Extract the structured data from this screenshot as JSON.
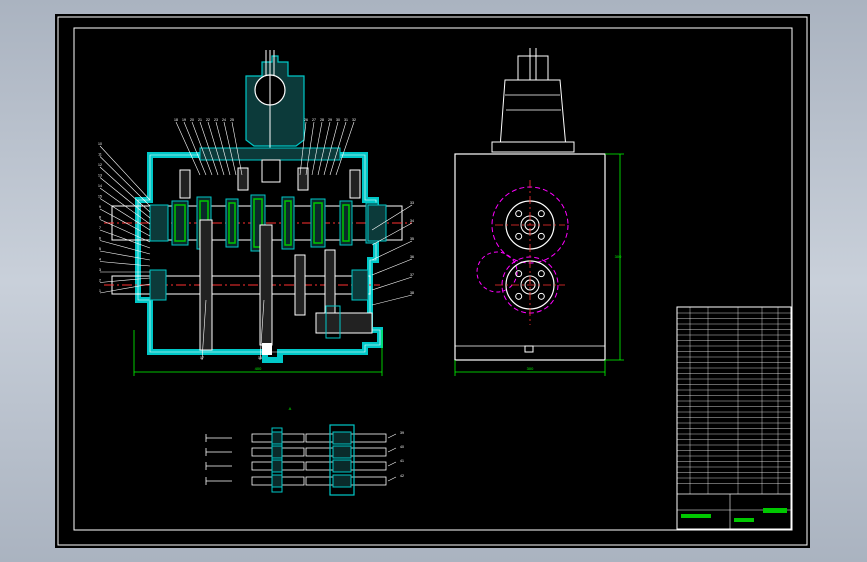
{
  "drawing": {
    "title_block_label": "",
    "section_label": "A",
    "dimensions": {
      "width_left": "400",
      "width_right": "300",
      "height_right": "300"
    },
    "balloons_top_left": [
      "18",
      "19",
      "20",
      "21",
      "22",
      "23",
      "24",
      "25"
    ],
    "balloons_top_right": [
      "26",
      "27",
      "28",
      "29",
      "30",
      "31",
      "32"
    ],
    "balloons_left": [
      "10",
      "11",
      "12",
      "13",
      "14",
      "15",
      "9",
      "8",
      "7",
      "6",
      "5",
      "4",
      "3",
      "2",
      "1"
    ],
    "balloons_right": [
      "33",
      "34",
      "35",
      "36",
      "37",
      "38"
    ],
    "balloons_bottom": [
      "17",
      "16"
    ],
    "rod_labels": [
      "39",
      "40",
      "41",
      "42"
    ],
    "colors": {
      "background": "#000000",
      "frame": "#ffffff",
      "housing": "#00c8c8",
      "gear_green": "#00c800",
      "centerline": "#ff3030",
      "pitch_circle": "#ff00ff",
      "dimension": "#00ff00"
    }
  }
}
